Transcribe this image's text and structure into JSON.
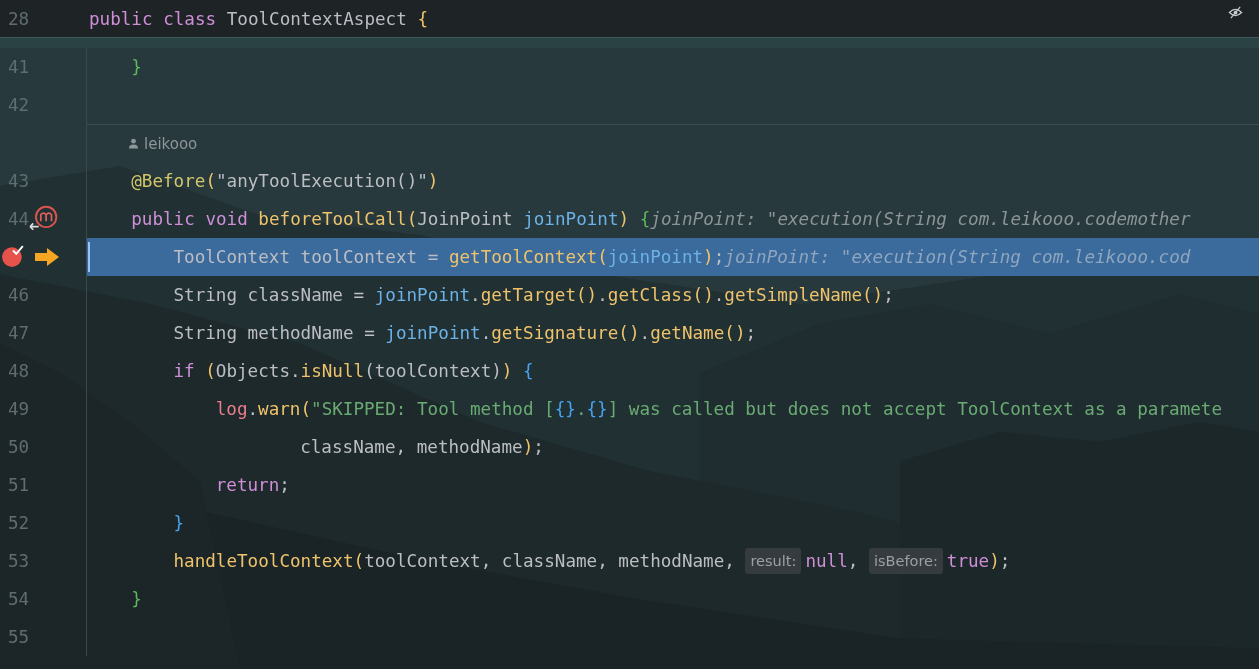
{
  "sticky_header": {
    "number": "28",
    "tokens": [
      {
        "text": "public ",
        "kind": "keyword"
      },
      {
        "text": "class ",
        "kind": "keyword"
      },
      {
        "text": "ToolContextAspect ",
        "kind": "plain"
      },
      {
        "text": "{",
        "kind": "brace-y"
      }
    ]
  },
  "lines": [
    {
      "kind": "code",
      "number": "41",
      "selected": false,
      "breakpoint": false,
      "execution_point": false,
      "method_marker": false,
      "tokens": [
        {
          "text": "    }",
          "kind": "brace-g"
        }
      ]
    },
    {
      "kind": "code",
      "number": "42",
      "selected": false,
      "breakpoint": false,
      "execution_point": false,
      "method_marker": false
    },
    {
      "kind": "author",
      "author": "leikooo"
    },
    {
      "kind": "code",
      "number": "43",
      "selected": false,
      "breakpoint": false,
      "execution_point": false,
      "method_marker": false,
      "tokens": [
        {
          "text": "    @Before",
          "kind": "annotation"
        },
        {
          "text": "(",
          "kind": "brace-y"
        },
        {
          "text": "\"anyToolExecution()\"",
          "kind": "plain"
        },
        {
          "text": ")",
          "kind": "brace-y"
        }
      ]
    },
    {
      "kind": "code",
      "number": "44",
      "selected": false,
      "breakpoint": false,
      "execution_point": false,
      "method_marker": true,
      "tokens": [
        {
          "text": "    public ",
          "kind": "keyword"
        },
        {
          "text": "void ",
          "kind": "keyword"
        },
        {
          "text": "beforeToolCall",
          "kind": "method"
        },
        {
          "text": "(",
          "kind": "brace-y"
        },
        {
          "text": "JoinPoint ",
          "kind": "plain"
        },
        {
          "text": "joinPoint",
          "kind": "param"
        },
        {
          "text": ") ",
          "kind": "brace-y"
        },
        {
          "text": "{",
          "kind": "brace-g"
        },
        {
          "text": "joinPoint: \"execution(String com.leikooo.codemother",
          "kind": "hint"
        }
      ]
    },
    {
      "kind": "code",
      "selected": true,
      "breakpoint": true,
      "execution_point": true,
      "method_marker": false,
      "tokens": [
        {
          "text": "        ToolContext toolContext = ",
          "kind": "plain"
        },
        {
          "text": "getToolContext",
          "kind": "method"
        },
        {
          "text": "(",
          "kind": "brace-y"
        },
        {
          "text": "joinPoint",
          "kind": "param"
        },
        {
          "text": ")",
          "kind": "brace-y"
        },
        {
          "text": ";",
          "kind": "plain"
        },
        {
          "text": "joinPoint: \"execution(String com.leikooo.cod",
          "kind": "hint"
        }
      ]
    },
    {
      "kind": "code",
      "number": "46",
      "selected": false,
      "breakpoint": false,
      "execution_point": false,
      "method_marker": false,
      "tokens": [
        {
          "text": "        String className = ",
          "kind": "plain"
        },
        {
          "text": "joinPoint",
          "kind": "param"
        },
        {
          "text": ".",
          "kind": "plain"
        },
        {
          "text": "getTarget()",
          "kind": "method"
        },
        {
          "text": ".",
          "kind": "plain"
        },
        {
          "text": "getClass()",
          "kind": "method"
        },
        {
          "text": ".",
          "kind": "plain"
        },
        {
          "text": "getSimpleName()",
          "kind": "method"
        },
        {
          "text": ";",
          "kind": "plain"
        }
      ]
    },
    {
      "kind": "code",
      "number": "47",
      "selected": false,
      "breakpoint": false,
      "execution_point": false,
      "method_marker": false,
      "tokens": [
        {
          "text": "        String methodName = ",
          "kind": "plain"
        },
        {
          "text": "joinPoint",
          "kind": "param"
        },
        {
          "text": ".",
          "kind": "plain"
        },
        {
          "text": "getSignature()",
          "kind": "method"
        },
        {
          "text": ".",
          "kind": "plain"
        },
        {
          "text": "getName()",
          "kind": "method"
        },
        {
          "text": ";",
          "kind": "plain"
        }
      ]
    },
    {
      "kind": "code",
      "number": "48",
      "selected": false,
      "breakpoint": false,
      "execution_point": false,
      "method_marker": false,
      "tokens": [
        {
          "text": "        if ",
          "kind": "keyword"
        },
        {
          "text": "(",
          "kind": "brace-y"
        },
        {
          "text": "Objects.",
          "kind": "plain"
        },
        {
          "text": "isNull",
          "kind": "method"
        },
        {
          "text": "(toolContext)",
          "kind": "plain"
        },
        {
          "text": ") ",
          "kind": "brace-y"
        },
        {
          "text": "{",
          "kind": "brace-b"
        }
      ]
    },
    {
      "kind": "code",
      "number": "49",
      "selected": false,
      "breakpoint": false,
      "execution_point": false,
      "method_marker": false,
      "tokens": [
        {
          "text": "            log",
          "kind": "field"
        },
        {
          "text": ".",
          "kind": "plain"
        },
        {
          "text": "warn",
          "kind": "method"
        },
        {
          "text": "(",
          "kind": "brace-y"
        },
        {
          "text": "\"SKIPPED: Tool method [",
          "kind": "string"
        },
        {
          "text": "{}",
          "kind": "brace-b"
        },
        {
          "text": ".",
          "kind": "string"
        },
        {
          "text": "{}",
          "kind": "brace-b"
        },
        {
          "text": "] was called but does not accept ToolContext as a paramete",
          "kind": "string"
        }
      ]
    },
    {
      "kind": "code",
      "number": "50",
      "selected": false,
      "breakpoint": false,
      "execution_point": false,
      "method_marker": false,
      "tokens": [
        {
          "text": "                    className, methodName",
          "kind": "plain"
        },
        {
          "text": ")",
          "kind": "brace-y"
        },
        {
          "text": ";",
          "kind": "plain"
        }
      ]
    },
    {
      "kind": "code",
      "number": "51",
      "selected": false,
      "breakpoint": false,
      "execution_point": false,
      "method_marker": false,
      "tokens": [
        {
          "text": "            return",
          "kind": "keyword"
        },
        {
          "text": ";",
          "kind": "plain"
        }
      ]
    },
    {
      "kind": "code",
      "number": "52",
      "selected": false,
      "breakpoint": false,
      "execution_point": false,
      "method_marker": false,
      "tokens": [
        {
          "text": "        }",
          "kind": "brace-b"
        }
      ]
    },
    {
      "kind": "code",
      "number": "53",
      "selected": false,
      "breakpoint": false,
      "execution_point": false,
      "method_marker": false,
      "tokens": [
        {
          "text": "        handleToolContext",
          "kind": "method"
        },
        {
          "text": "(",
          "kind": "brace-y"
        },
        {
          "text": "toolContext, className, methodName, ",
          "kind": "plain"
        },
        {
          "text": "result:",
          "kind": "inlay"
        },
        {
          "text": "null",
          "kind": "keyword"
        },
        {
          "text": ", ",
          "kind": "plain"
        },
        {
          "text": "isBefore:",
          "kind": "inlay"
        },
        {
          "text": "true",
          "kind": "keyword"
        },
        {
          "text": ")",
          "kind": "brace-y"
        },
        {
          "text": ";",
          "kind": "plain"
        }
      ]
    },
    {
      "kind": "code",
      "number": "54",
      "selected": false,
      "breakpoint": false,
      "execution_point": false,
      "method_marker": false,
      "tokens": [
        {
          "text": "    }",
          "kind": "brace-g"
        }
      ]
    },
    {
      "kind": "code",
      "number": "55",
      "selected": false,
      "breakpoint": false,
      "execution_point": false,
      "method_marker": false
    }
  ]
}
